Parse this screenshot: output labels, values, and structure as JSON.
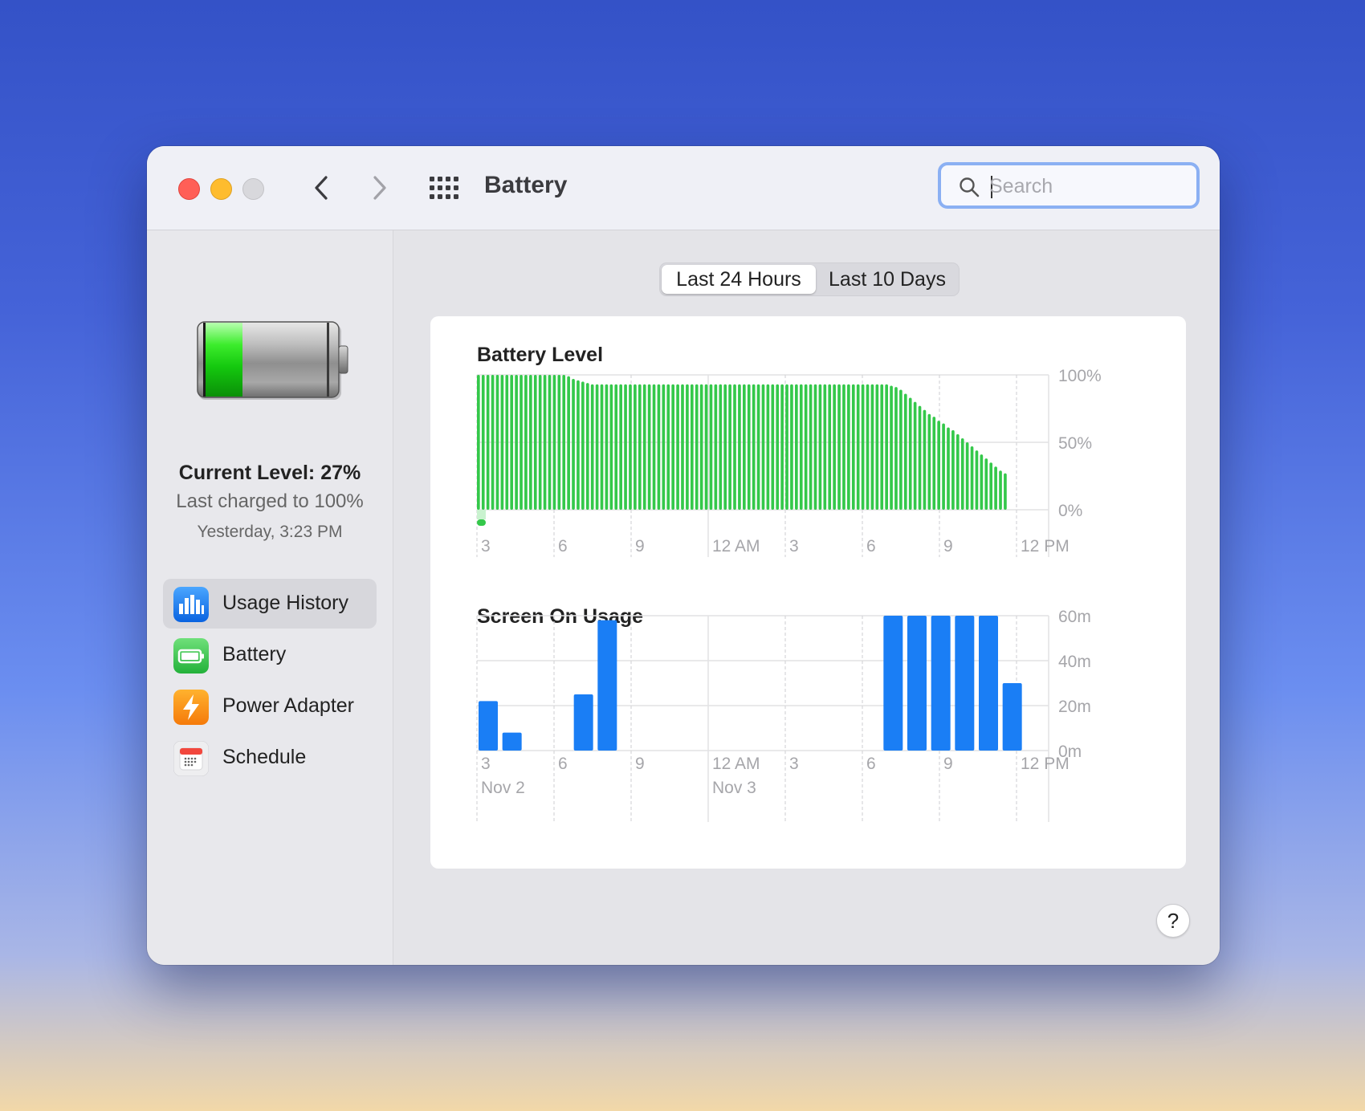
{
  "window": {
    "title": "Battery"
  },
  "search": {
    "placeholder": "Search"
  },
  "sidebar": {
    "current_level": "Current Level: 27%",
    "last_charged": "Last charged to 100%",
    "charged_time": "Yesterday, 3:23 PM",
    "items": [
      {
        "label": "Usage History",
        "icon": "usage-history-icon",
        "active": true
      },
      {
        "label": "Battery",
        "icon": "battery-icon",
        "active": false
      },
      {
        "label": "Power Adapter",
        "icon": "power-adapter-icon",
        "active": false
      },
      {
        "label": "Schedule",
        "icon": "schedule-icon",
        "active": false
      }
    ]
  },
  "tabs": [
    {
      "label": "Last 24 Hours",
      "selected": true
    },
    {
      "label": "Last 10 Days",
      "selected": false
    }
  ],
  "help_label": "?",
  "colors": {
    "battery_bar": "#34c84a",
    "usage_bar": "#1a7ef5",
    "search_focus": "#8bb0f3"
  },
  "chart_data": [
    {
      "type": "bar",
      "title": "Battery Level",
      "y_ticks": [
        "100%",
        "50%",
        "0%"
      ],
      "ylim": [
        0,
        100
      ],
      "x_ticks": [
        "3",
        "6",
        "9",
        "12 AM",
        "3",
        "6",
        "9",
        "12 PM"
      ],
      "values": [
        100,
        100,
        100,
        100,
        100,
        100,
        100,
        100,
        100,
        100,
        100,
        100,
        100,
        100,
        100,
        100,
        100,
        100,
        100,
        99,
        97,
        96,
        95,
        94,
        93,
        93,
        93,
        93,
        93,
        93,
        93,
        93,
        93,
        93,
        93,
        93,
        93,
        93,
        93,
        93,
        93,
        93,
        93,
        93,
        93,
        93,
        93,
        93,
        93,
        93,
        93,
        93,
        93,
        93,
        93,
        93,
        93,
        93,
        93,
        93,
        93,
        93,
        93,
        93,
        93,
        93,
        93,
        93,
        93,
        93,
        93,
        93,
        93,
        93,
        93,
        93,
        93,
        93,
        93,
        93,
        93,
        93,
        93,
        93,
        93,
        93,
        93,
        92,
        91,
        89,
        86,
        83,
        80,
        77,
        74,
        71,
        69,
        66,
        64,
        61,
        59,
        56,
        53,
        50,
        47,
        44,
        41,
        38,
        35,
        32,
        29,
        27
      ]
    },
    {
      "type": "bar",
      "title": "Screen On Usage",
      "y_ticks": [
        "60m",
        "40m",
        "20m",
        "0m"
      ],
      "ylim": [
        0,
        60
      ],
      "x_ticks": [
        "3",
        "6",
        "9",
        "12 AM",
        "3",
        "6",
        "9",
        "12 PM"
      ],
      "date_labels": [
        "Nov 2",
        "Nov 3"
      ],
      "values": [
        22,
        8,
        0,
        0,
        25,
        58,
        0,
        0,
        0,
        0,
        0,
        0,
        0,
        0,
        0,
        0,
        0,
        60,
        60,
        60,
        60,
        60,
        30,
        0
      ]
    }
  ]
}
